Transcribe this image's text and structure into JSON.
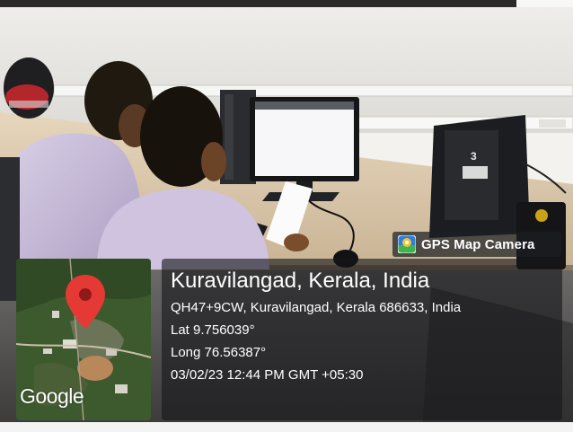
{
  "app": {
    "name": "GPS Map Camera",
    "icon": "gps-map-camera-icon"
  },
  "map": {
    "pin_icon": "map-pin-icon",
    "logo_text": "Google"
  },
  "location": {
    "title": "Kuravilangad, Kerala, India",
    "address": "QH47+9CW, Kuravilangad, Kerala 686633, India",
    "lat": "Lat 9.756039°",
    "long": "Long 76.56387°",
    "datetime": "03/02/23 12:44 PM GMT +05:30"
  },
  "colors": {
    "pin": "#e53935",
    "overlay_text": "#ffffff",
    "panel_bg": "#16161a"
  }
}
